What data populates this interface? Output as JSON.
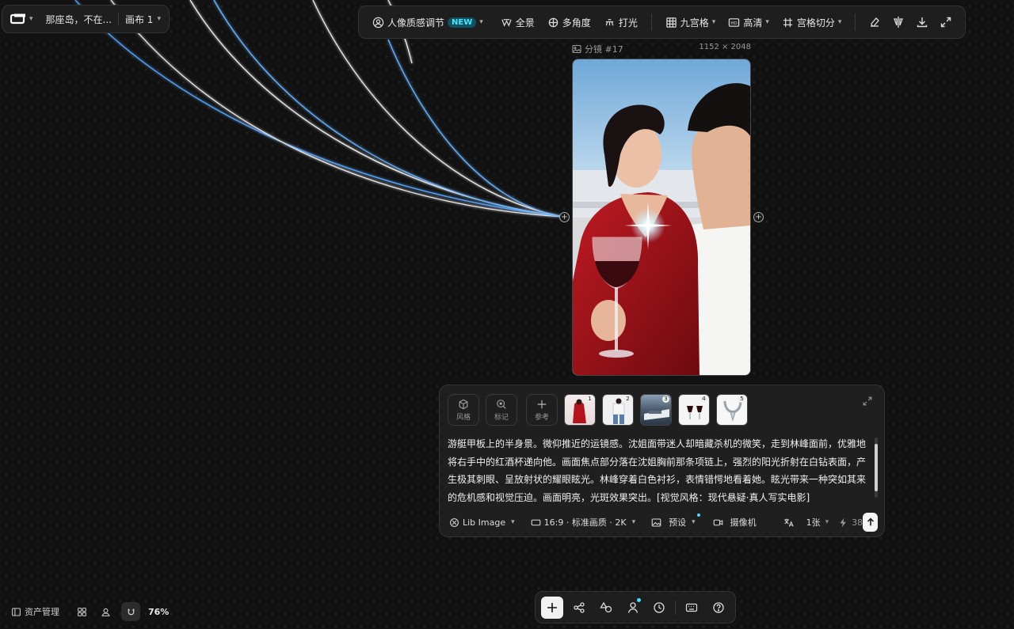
{
  "header": {
    "project_title": "那座岛，不在...",
    "canvas_label": "画布 1"
  },
  "toolbar": {
    "portrait_label": "人像质感调节",
    "new_badge": "NEW",
    "panorama_label": "全景",
    "multi_angle_label": "多角度",
    "lighting_label": "打光",
    "nine_grid_label": "九宫格",
    "hd_label": "高清",
    "grid_cut_label": "宫格切分"
  },
  "frame": {
    "title": "分镜 #17",
    "size": "1152 × 2048"
  },
  "prompt": {
    "style_label": "风格",
    "mark_label": "标记",
    "reference_label": "参考",
    "thumbnails": [
      "1",
      "2",
      "3",
      "4",
      "5"
    ],
    "text": "游艇甲板上的半身景。微仰推近的运镜感。沈姐面带迷人却暗藏杀机的微笑，走到林峰面前，优雅地将右手中的红酒杯递向他。画面焦点部分落在沈姐胸前那条项链上，强烈的阳光折射在白钻表面，产生极其刺眼、呈放射状的耀眼眩光。林峰穿着白色衬衫，表情错愕地看着她。眩光带来一种突如其来的危机感和视觉压迫。画面明亮，光斑效果突出。[视觉风格：现代悬疑·真人写实电影]",
    "model_label": "Lib Image",
    "ratio_label": "16:9 · 标准画质 · 2K",
    "preset_label": "预设",
    "camera_label": "摄像机",
    "count_label": "1张",
    "credits": "38"
  },
  "bottom_left": {
    "assets_label": "资产管理",
    "zoom": "76%"
  },
  "colors": {
    "accent": "#4fe3ff",
    "background": "#121212",
    "panel": "#1f1f1f"
  }
}
